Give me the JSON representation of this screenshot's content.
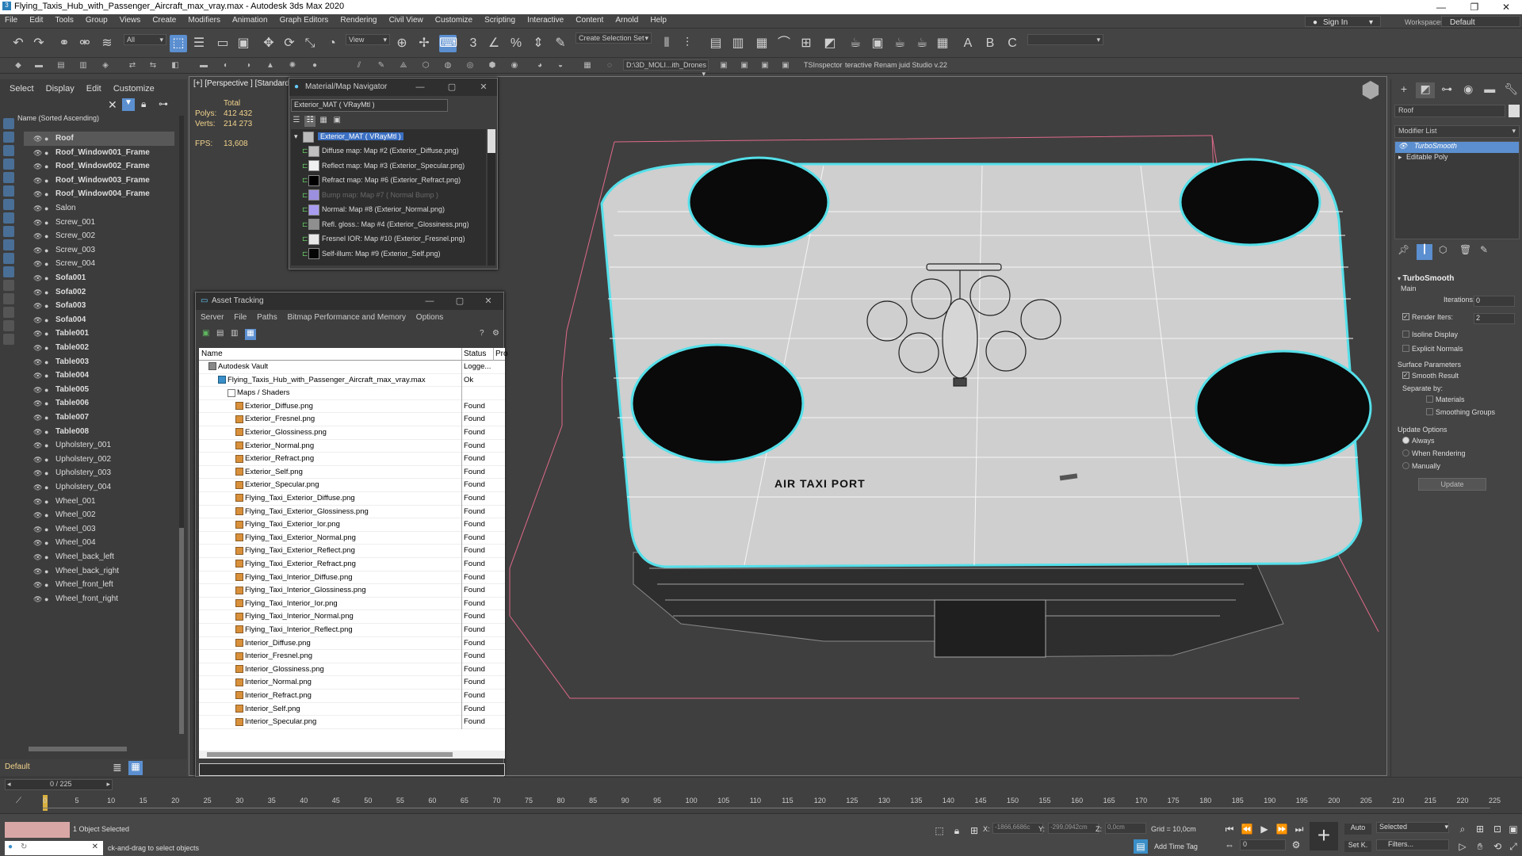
{
  "window": {
    "title": "Flying_Taxis_Hub_with_Passenger_Aircraft_max_vray.max - Autodesk 3ds Max 2020",
    "minimize": "—",
    "maximize": "❐",
    "close": "✕"
  },
  "menu": [
    "File",
    "Edit",
    "Tools",
    "Group",
    "Views",
    "Create",
    "Modifiers",
    "Animation",
    "Graph Editors",
    "Rendering",
    "Civil View",
    "Customize",
    "Scripting",
    "Interactive",
    "Content",
    "Arnold",
    "Help"
  ],
  "account": {
    "sign_in": "Sign In",
    "workspaces_label": "Workspaces:",
    "workspace": "Default"
  },
  "toolbar": {
    "filter_all": "All",
    "view_dropdown": "View",
    "create_selection_set": "Create Selection Set",
    "project_path": "D:\\3D_MOLI...ith_Drones",
    "tsinspector": "TSInspector",
    "renam": "teractive Renam juid Studio v.22"
  },
  "scene_explorer": {
    "tabs": [
      "Select",
      "Display",
      "Edit",
      "Customize"
    ],
    "column_header": "Name (Sorted Ascending)",
    "items": [
      {
        "label": "Roof",
        "bold": true,
        "selected": true
      },
      {
        "label": "Roof_Window001_Frame",
        "bold": true
      },
      {
        "label": "Roof_Window002_Frame",
        "bold": true
      },
      {
        "label": "Roof_Window003_Frame",
        "bold": true
      },
      {
        "label": "Roof_Window004_Frame",
        "bold": true
      },
      {
        "label": "Salon",
        "bold": false
      },
      {
        "label": "Screw_001",
        "bold": false
      },
      {
        "label": "Screw_002",
        "bold": false
      },
      {
        "label": "Screw_003",
        "bold": false
      },
      {
        "label": "Screw_004",
        "bold": false
      },
      {
        "label": "Sofa001",
        "bold": true
      },
      {
        "label": "Sofa002",
        "bold": true
      },
      {
        "label": "Sofa003",
        "bold": true
      },
      {
        "label": "Sofa004",
        "bold": true
      },
      {
        "label": "Table001",
        "bold": true
      },
      {
        "label": "Table002",
        "bold": true
      },
      {
        "label": "Table003",
        "bold": true
      },
      {
        "label": "Table004",
        "bold": true
      },
      {
        "label": "Table005",
        "bold": true
      },
      {
        "label": "Table006",
        "bold": true
      },
      {
        "label": "Table007",
        "bold": true
      },
      {
        "label": "Table008",
        "bold": true
      },
      {
        "label": "Upholstery_001",
        "bold": false
      },
      {
        "label": "Upholstery_002",
        "bold": false
      },
      {
        "label": "Upholstery_003",
        "bold": false
      },
      {
        "label": "Upholstery_004",
        "bold": false
      },
      {
        "label": "Wheel_001",
        "bold": false
      },
      {
        "label": "Wheel_002",
        "bold": false
      },
      {
        "label": "Wheel_003",
        "bold": false
      },
      {
        "label": "Wheel_004",
        "bold": false
      },
      {
        "label": "Wheel_back_left",
        "bold": false
      },
      {
        "label": "Wheel_back_right",
        "bold": false
      },
      {
        "label": "Wheel_front_left",
        "bold": false
      },
      {
        "label": "Wheel_front_right",
        "bold": false
      }
    ],
    "layer": "Default"
  },
  "viewport": {
    "label_plus": "[+]",
    "label_view": "[Perspective ]",
    "label_shading": "[Standard",
    "stats_total": "Total",
    "polys_label": "Polys:",
    "polys": "412 432",
    "verts_label": "Verts:",
    "verts": "214 273",
    "fps_label": "FPS:",
    "fps": "13,608",
    "sign_text": "AIR TAXI PORT"
  },
  "material_navigator": {
    "title": "Material/Map Navigator",
    "name_field": "Exterior_MAT  ( VRayMtl )",
    "root": "Exterior_MAT  ( VRayMtl )",
    "maps": [
      {
        "label": "Diffuse map: Map #2 (Exterior_Diffuse.png)",
        "swatch": "#bfbfbf",
        "dim": false
      },
      {
        "label": "Reflect map: Map #3 (Exterior_Specular.png)",
        "swatch": "#f0f0f0",
        "dim": false
      },
      {
        "label": "Refract map: Map #6 (Exterior_Refract.png)",
        "swatch": "#000000",
        "dim": false
      },
      {
        "label": "Bump map: Map #7  ( Normal Bump )",
        "swatch": "#9b8fe0",
        "dim": true
      },
      {
        "label": "Normal: Map #8 (Exterior_Normal.png)",
        "swatch": "#a89cf0",
        "dim": false
      },
      {
        "label": "Refl. gloss.: Map #4 (Exterior_Glossiness.png)",
        "swatch": "#8f8f8f",
        "dim": false
      },
      {
        "label": "Fresnel IOR: Map #10 (Exterior_Fresnel.png)",
        "swatch": "#e8e8e8",
        "dim": false
      },
      {
        "label": "Self-illum: Map #9 (Exterior_Self.png)",
        "swatch": "#050505",
        "dim": false
      }
    ]
  },
  "asset_tracking": {
    "title": "Asset Tracking",
    "menu": [
      "Server",
      "File",
      "Paths",
      "Bitmap Performance and Memory",
      "Options"
    ],
    "columns": {
      "name": "Name",
      "status": "Status",
      "extra": "Pro"
    },
    "vault": {
      "name": "Autodesk Vault",
      "status": "Logge..."
    },
    "file": {
      "name": "Flying_Taxis_Hub_with_Passenger_Aircraft_max_vray.max",
      "status": "Ok"
    },
    "group": "Maps / Shaders",
    "files": [
      "Exterior_Diffuse.png",
      "Exterior_Fresnel.png",
      "Exterior_Glossiness.png",
      "Exterior_Normal.png",
      "Exterior_Refract.png",
      "Exterior_Self.png",
      "Exterior_Specular.png",
      "Flying_Taxi_Exterior_Diffuse.png",
      "Flying_Taxi_Exterior_Glossiness.png",
      "Flying_Taxi_Exterior_Ior.png",
      "Flying_Taxi_Exterior_Normal.png",
      "Flying_Taxi_Exterior_Reflect.png",
      "Flying_Taxi_Exterior_Refract.png",
      "Flying_Taxi_Interior_Diffuse.png",
      "Flying_Taxi_Interior_Glossiness.png",
      "Flying_Taxi_Interior_Ior.png",
      "Flying_Taxi_Interior_Normal.png",
      "Flying_Taxi_Interior_Reflect.png",
      "Interior_Diffuse.png",
      "Interior_Fresnel.png",
      "Interior_Glossiness.png",
      "Interior_Normal.png",
      "Interior_Refract.png",
      "Interior_Self.png",
      "Interior_Specular.png"
    ],
    "file_status": "Found"
  },
  "command_panel": {
    "object_name": "Roof",
    "modifier_list": "Modifier List",
    "stack": [
      "TurboSmooth",
      "Editable Poly"
    ],
    "turbosmooth": {
      "title": "TurboSmooth",
      "main": "Main",
      "iterations_label": "Iterations:",
      "iterations": "0",
      "render_iters_label": "Render Iters:",
      "render_iters": "2",
      "isoline": "Isoline Display",
      "explicit_normals": "Explicit Normals",
      "surface_params": "Surface Parameters",
      "smooth_result": "Smooth Result",
      "separate_by": "Separate by:",
      "materials": "Materials",
      "smoothing_groups": "Smoothing Groups",
      "update_options": "Update Options",
      "always": "Always",
      "when_rendering": "When Rendering",
      "manually": "Manually",
      "update": "Update"
    }
  },
  "timeline": {
    "frame": "0 / 225",
    "ticks": [
      "0",
      "5",
      "10",
      "15",
      "20",
      "25",
      "30",
      "35",
      "40",
      "45",
      "50",
      "55",
      "60",
      "65",
      "70",
      "75",
      "80",
      "85",
      "90",
      "95",
      "100",
      "105",
      "110",
      "115",
      "120",
      "125",
      "130",
      "135",
      "140",
      "145",
      "150",
      "155",
      "160",
      "165",
      "170",
      "175",
      "180",
      "185",
      "190",
      "195",
      "200",
      "205",
      "210",
      "215",
      "220",
      "225"
    ]
  },
  "status": {
    "selection": "1 Object Selected",
    "prompt": "ck-and-drag to select objects",
    "x_label": "X:",
    "x": "-1866,6686c",
    "y_label": "Y:",
    "y": "-299,0942cm",
    "z_label": "Z:",
    "z": "0,0cm",
    "grid": "Grid = 10,0cm",
    "add_time_tag": "Add Time Tag",
    "auto": "Auto",
    "set_k": "Set K.",
    "selected": "Selected",
    "filters": "Filters...",
    "frame_field": "0"
  }
}
